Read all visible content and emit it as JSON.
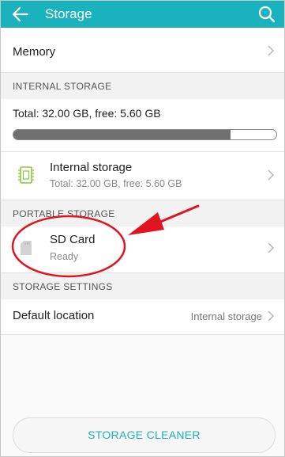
{
  "appbar": {
    "title": "Storage",
    "back_icon": "arrow-back-icon",
    "search_icon": "search-icon"
  },
  "memory": {
    "label": "Memory"
  },
  "internal_section": {
    "header": "INTERNAL STORAGE",
    "total_text": "Total: 32.00 GB, free: 5.60 GB",
    "used_fraction": 0.825
  },
  "internal_item": {
    "title": "Internal storage",
    "subtitle": "Total: 32.00 GB, free: 5.60 GB",
    "icon": "chip-icon"
  },
  "portable_section": {
    "header": "PORTABLE STORAGE"
  },
  "sd_item": {
    "title": "SD Card",
    "subtitle": "Ready",
    "icon": "sd-card-icon"
  },
  "settings_section": {
    "header": "STORAGE SETTINGS",
    "default_location_label": "Default location",
    "default_location_value": "Internal storage"
  },
  "cleaner": {
    "label": "STORAGE CLEANER"
  },
  "colors": {
    "accent": "#1ab2bd",
    "annotation": "#e0141e"
  }
}
